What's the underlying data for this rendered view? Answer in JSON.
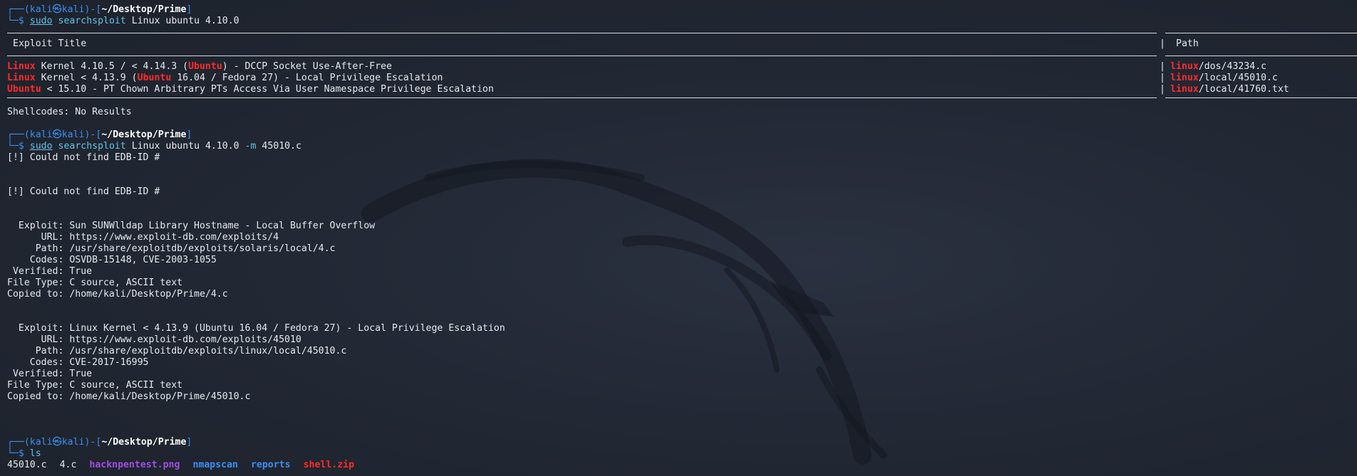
{
  "prompt": {
    "corner_top": "┌──(",
    "user": "kali",
    "at": "㉿",
    "host": "kali",
    "sep": ")-[",
    "path": "~/Desktop/Prime",
    "close": "]",
    "corner_bot": "└─",
    "dollar": "$"
  },
  "commands": {
    "cmd1": {
      "sudo": "sudo",
      "bin": "searchsploit",
      "args": "Linux ubuntu 4.10.0"
    },
    "cmd2": {
      "sudo": "sudo",
      "bin": "searchsploit",
      "args_pre": "Linux ubuntu 4.10.0 ",
      "flag": "-m",
      "args_post": " 45010.c"
    },
    "cmd3": {
      "bin": "ls"
    }
  },
  "table": {
    "header_title": "Exploit Title",
    "header_path": "Path",
    "pipe": "|",
    "rows": [
      {
        "t1": "Linux",
        "t2": " Kernel 4.10.5 / < 4.14.3 (",
        "t3": "Ubuntu",
        "t4": ") - DCCP Socket Use-After-Free",
        "p1": "linux",
        "p2": "/dos/43234.c"
      },
      {
        "t1": "Linux",
        "t2": " Kernel < 4.13.9 (",
        "t3": "Ubuntu",
        "t4": " 16.04 / Fedora 27) - Local Privilege Escalation",
        "p1": "linux",
        "p2": "/local/45010.c"
      },
      {
        "t1": "Ubuntu",
        "t2": " < 15.10 - PT Chown Arbitrary PTs Access Via User Namespace Privilege Escalation",
        "t3": "",
        "t4": "",
        "p1": "linux",
        "p2": "/local/41760.txt"
      }
    ]
  },
  "shellcodes": "Shellcodes: No Results",
  "edb_error": "[!] Could not find EDB-ID #",
  "exploit1": [
    "  Exploit: Sun SUNWlldap Library Hostname - Local Buffer Overflow",
    "      URL: https://www.exploit-db.com/exploits/4",
    "     Path: /usr/share/exploitdb/exploits/solaris/local/4.c",
    "    Codes: OSVDB-15148, CVE-2003-1055",
    " Verified: True",
    "File Type: C source, ASCII text",
    "Copied to: /home/kali/Desktop/Prime/4.c"
  ],
  "exploit2": [
    "  Exploit: Linux Kernel < 4.13.9 (Ubuntu 16.04 / Fedora 27) - Local Privilege Escalation",
    "      URL: https://www.exploit-db.com/exploits/45010",
    "     Path: /usr/share/exploitdb/exploits/linux/local/45010.c",
    "    Codes: CVE-2017-16995",
    " Verified: True",
    "File Type: C source, ASCII text",
    "Copied to: /home/kali/Desktop/Prime/45010.c"
  ],
  "ls_output": {
    "f1": "45010.c",
    "f2": "4.c",
    "f3": "hacknpentest.png",
    "f4": "nmapscan",
    "f5": "reports",
    "f6": "shell.zip"
  }
}
